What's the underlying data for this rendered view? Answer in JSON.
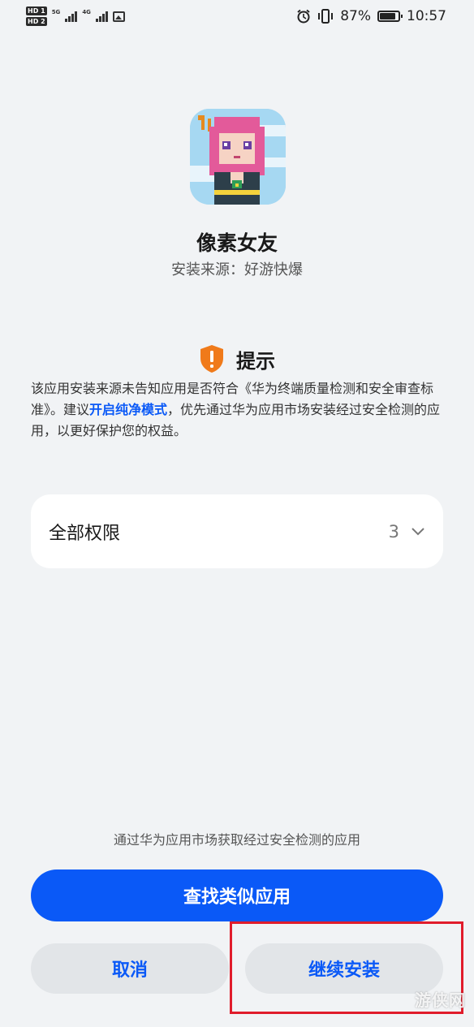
{
  "status_bar": {
    "sim1_badge": "HD 1",
    "sim2_badge": "HD 2",
    "network1": "5G",
    "network2": "4G",
    "battery": "87%",
    "time": "10:57"
  },
  "app": {
    "name": "像素女友",
    "source": "安装来源：好游快爆"
  },
  "notice": {
    "title": "提示",
    "text_before": "该应用安装来源未告知应用是否符合《华为终端质量检测和安全审查标准》。建议",
    "link": "开启纯净模式",
    "text_after": "，优先通过华为应用市场安装经过安全检测的应用，以更好保护您的权益。"
  },
  "permissions": {
    "label": "全部权限",
    "count": "3"
  },
  "bottom": {
    "hint": "通过华为应用市场获取经过安全检测的应用",
    "find_similar": "查找类似应用",
    "cancel": "取消",
    "continue_install": "继续安装"
  },
  "watermark": "游侠网",
  "colors": {
    "accent": "#0a59f7",
    "warning": "#f07a1a",
    "highlight": "#e01c2b",
    "background": "#f1f3f5"
  },
  "icons": [
    "alarm-icon",
    "vibrate-icon",
    "battery-icon",
    "image-notification-icon",
    "shield-warning-icon",
    "chevron-down-icon"
  ]
}
